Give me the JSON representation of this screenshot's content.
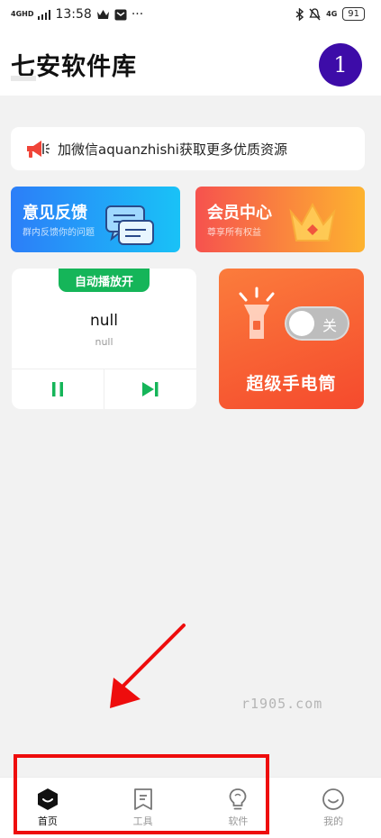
{
  "status_bar": {
    "network": "4GHD",
    "time": "13:58",
    "right_network": "4G",
    "battery": "91"
  },
  "header": {
    "title": "七安软件库",
    "avatar_text": "1"
  },
  "notice": {
    "text": "加微信aquanzhishi获取更多优质资源",
    "icon": "megaphone-icon"
  },
  "cards": {
    "feedback": {
      "title": "意见反馈",
      "subtitle": "群内反馈你的问题",
      "icon": "chat-bubbles-icon"
    },
    "vip": {
      "title": "会员中心",
      "subtitle": "尊享所有权益",
      "icon": "crown-icon"
    }
  },
  "player": {
    "autoplay_label": "自动播放开",
    "song": "null",
    "artist": "null",
    "pause_icon": "pause-icon",
    "next_icon": "skip-next-icon"
  },
  "flashlight": {
    "title": "超级手电筒",
    "toggle_label": "关",
    "toggle_on": false,
    "icon": "flashlight-icon"
  },
  "watermark": "r1905.com",
  "tabs": [
    {
      "label": "首页",
      "icon": "home-icon",
      "active": true
    },
    {
      "label": "工具",
      "icon": "bookmark-icon",
      "active": false
    },
    {
      "label": "软件",
      "icon": "lightbulb-icon",
      "active": false
    },
    {
      "label": "我的",
      "icon": "smiley-icon",
      "active": false
    }
  ],
  "colors": {
    "accent_green": "#15b559",
    "avatar": "#3d0ca8",
    "annotation_red": "#ee0d0d",
    "feedback_gradient": [
      "#2c7ef8",
      "#19c2f7"
    ],
    "vip_gradient": [
      "#f6524e",
      "#fdb32f"
    ],
    "flashlight_gradient": [
      "#fb7c3c",
      "#f54a2d"
    ]
  }
}
